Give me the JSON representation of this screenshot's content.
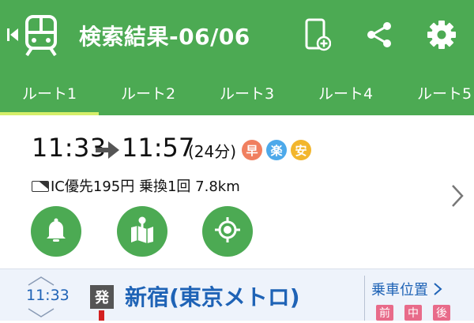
{
  "header": {
    "title": "検索結果-06/06",
    "icons": [
      "back-icon",
      "train-icon",
      "phone-add-icon",
      "share-icon",
      "settings-icon"
    ],
    "bg_color": "#4caa53"
  },
  "tabs": [
    {
      "label": "ルート1",
      "selected": true
    },
    {
      "label": "ルート2",
      "selected": false
    },
    {
      "label": "ルート3",
      "selected": false
    },
    {
      "label": "ルート4",
      "selected": false
    },
    {
      "label": "ルート5",
      "selected": false
    }
  ],
  "route": {
    "depart": "11:33",
    "arrive": "11:57",
    "duration": "(24分)",
    "badges": [
      {
        "label": "早",
        "color": "#f07f5f"
      },
      {
        "label": "楽",
        "color": "#4da9ea"
      },
      {
        "label": "安",
        "color": "#f2b62d"
      }
    ],
    "fare": "IC優先195円",
    "transfers": "乗換1回",
    "distance": "7.8km",
    "actions": [
      "bell-icon",
      "map-pin-icon",
      "locate-icon"
    ]
  },
  "section": {
    "time": "11:33",
    "dep_label": "発",
    "station": "新宿(東京メトロ)",
    "boarding_position": "乗車位置",
    "positions": [
      "前",
      "中",
      "後"
    ],
    "line_color": "#d32020"
  }
}
